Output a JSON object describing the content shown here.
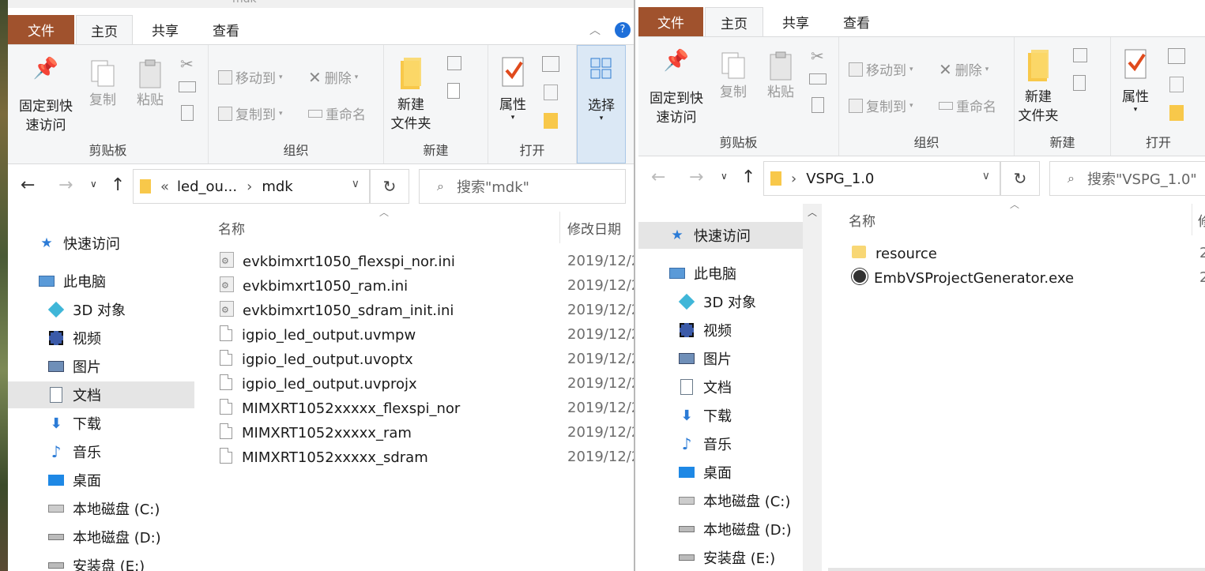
{
  "left": {
    "title": "mdk",
    "tabs": {
      "file": "文件",
      "home": "主页",
      "share": "共享",
      "view": "查看"
    },
    "ribbon": {
      "pin": "固定到快\n速访问",
      "copy": "复制",
      "paste": "粘贴",
      "move_to": "移动到",
      "delete": "删除",
      "copy_to": "复制到",
      "rename": "重命名",
      "new_folder": "新建\n文件夹",
      "properties": "属性",
      "select": "选择",
      "groups": {
        "clipboard": "剪贴板",
        "organize": "组织",
        "new": "新建",
        "open": "打开"
      }
    },
    "address": {
      "path_prefix": "«",
      "crumb1": "led_ou...",
      "crumb2": "mdk",
      "search_placeholder": "搜索\"mdk\""
    },
    "nav": [
      {
        "label": "快速访问",
        "icon": "star-icon"
      },
      {
        "label": "此电脑",
        "icon": "computer-icon"
      },
      {
        "label": "3D 对象",
        "icon": "3d-objects-icon"
      },
      {
        "label": "视频",
        "icon": "video-icon"
      },
      {
        "label": "图片",
        "icon": "pictures-icon"
      },
      {
        "label": "文档",
        "icon": "documents-icon"
      },
      {
        "label": "下载",
        "icon": "download-icon"
      },
      {
        "label": "音乐",
        "icon": "music-icon"
      },
      {
        "label": "桌面",
        "icon": "desktop-icon"
      },
      {
        "label": "本地磁盘 (C:)",
        "icon": "drive-c-icon"
      },
      {
        "label": "本地磁盘 (D:)",
        "icon": "drive-icon"
      },
      {
        "label": "安装盘 (E:)",
        "icon": "drive-icon"
      }
    ],
    "columns": {
      "name": "名称",
      "date": "修改日期"
    },
    "files": [
      {
        "name": "evkbimxrt1050_flexspi_nor.ini",
        "date": "2019/12/2",
        "icon": "ini-file-icon"
      },
      {
        "name": "evkbimxrt1050_ram.ini",
        "date": "2019/12/2",
        "icon": "ini-file-icon"
      },
      {
        "name": "evkbimxrt1050_sdram_init.ini",
        "date": "2019/12/2",
        "icon": "ini-file-icon"
      },
      {
        "name": "igpio_led_output.uvmpw",
        "date": "2019/12/2",
        "icon": "file-icon"
      },
      {
        "name": "igpio_led_output.uvoptx",
        "date": "2019/12/2",
        "icon": "file-icon"
      },
      {
        "name": "igpio_led_output.uvprojx",
        "date": "2019/12/2",
        "icon": "file-icon"
      },
      {
        "name": "MIMXRT1052xxxxx_flexspi_nor",
        "date": "2019/12/2",
        "icon": "file-icon"
      },
      {
        "name": "MIMXRT1052xxxxx_ram",
        "date": "2019/12/2",
        "icon": "file-icon"
      },
      {
        "name": "MIMXRT1052xxxxx_sdram",
        "date": "2019/12/2",
        "icon": "file-icon"
      }
    ]
  },
  "right": {
    "tabs": {
      "file": "文件",
      "home": "主页",
      "share": "共享",
      "view": "查看"
    },
    "ribbon": {
      "pin": "固定到快\n速访问",
      "copy": "复制",
      "paste": "粘贴",
      "move_to": "移动到",
      "delete": "删除",
      "copy_to": "复制到",
      "rename": "重命名",
      "new_folder": "新建\n文件夹",
      "properties": "属性",
      "groups": {
        "clipboard": "剪贴板",
        "organize": "组织",
        "new": "新建",
        "open": "打开"
      }
    },
    "address": {
      "crumb1": "VSPG_1.0",
      "search_placeholder": "搜索\"VSPG_1.0\""
    },
    "nav": [
      {
        "label": "快速访问",
        "icon": "star-icon"
      },
      {
        "label": "此电脑",
        "icon": "computer-icon"
      },
      {
        "label": "3D 对象",
        "icon": "3d-objects-icon"
      },
      {
        "label": "视频",
        "icon": "video-icon"
      },
      {
        "label": "图片",
        "icon": "pictures-icon"
      },
      {
        "label": "文档",
        "icon": "documents-icon"
      },
      {
        "label": "下载",
        "icon": "download-icon"
      },
      {
        "label": "音乐",
        "icon": "music-icon"
      },
      {
        "label": "桌面",
        "icon": "desktop-icon"
      },
      {
        "label": "本地磁盘 (C:)",
        "icon": "drive-c-icon"
      },
      {
        "label": "本地磁盘 (D:)",
        "icon": "drive-icon"
      },
      {
        "label": "安装盘 (E:)",
        "icon": "drive-icon"
      }
    ],
    "columns": {
      "name": "名称",
      "date": "修"
    },
    "files": [
      {
        "name": "resource",
        "date": "2",
        "icon": "folder-icon"
      },
      {
        "name": "EmbVSProjectGenerator.exe",
        "date": "2",
        "icon": "exe-icon"
      }
    ]
  },
  "colors": {
    "file_tab": "#a0522d",
    "ribbon_bg": "#f5f6f7",
    "nav_selected": "#e5e5e5",
    "help": "#1e6fd9"
  }
}
